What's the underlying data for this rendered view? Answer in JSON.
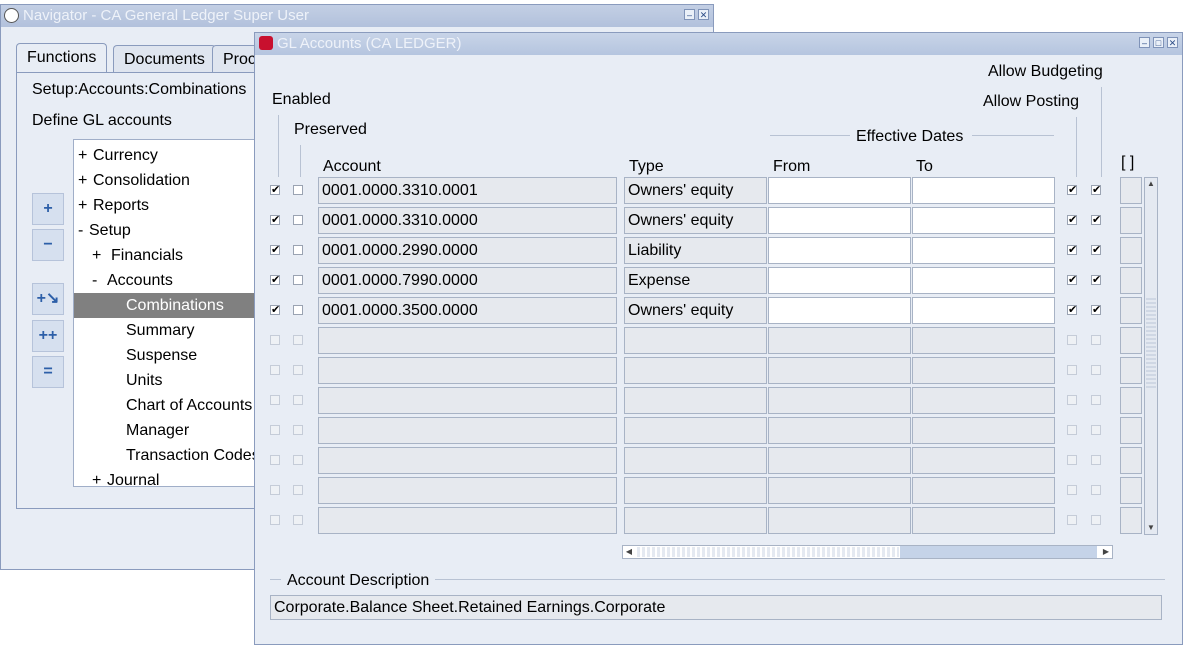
{
  "navigator": {
    "title": "Navigator - CA General Ledger Super User",
    "tabs": [
      "Functions",
      "Documents",
      "Proc"
    ],
    "path": "Setup:Accounts:Combinations",
    "description": "Define GL accounts",
    "tree": [
      {
        "prefix": "+",
        "label": "Currency"
      },
      {
        "prefix": "+",
        "label": "Consolidation"
      },
      {
        "prefix": "+",
        "label": "Reports"
      },
      {
        "prefix": "-",
        "label": "Setup"
      },
      {
        "prefix": "+",
        "label": "Financials"
      },
      {
        "prefix": "-",
        "label": "Accounts"
      },
      {
        "prefix": "",
        "label": "Combinations"
      },
      {
        "prefix": "",
        "label": "Summary"
      },
      {
        "prefix": "",
        "label": "Suspense"
      },
      {
        "prefix": "",
        "label": "Units"
      },
      {
        "prefix": "",
        "label": "Chart of Accounts"
      },
      {
        "prefix": "",
        "label": "Manager"
      },
      {
        "prefix": "",
        "label": "Transaction Codes"
      },
      {
        "prefix": "+",
        "label": "Journal"
      }
    ]
  },
  "gl": {
    "title": "GL Accounts (CA LEDGER)",
    "headers": {
      "enabled": "Enabled",
      "preserved": "Preserved",
      "account": "Account",
      "type": "Type",
      "effective_dates": "Effective Dates",
      "from": "From",
      "to": "To",
      "allow_budgeting": "Allow Budgeting",
      "allow_posting": "Allow Posting",
      "flex": "[ ]"
    },
    "rows": [
      {
        "enabled": true,
        "preserved": false,
        "account": "0001.0000.3310.0001",
        "type": "Owners' equity",
        "from": "",
        "to": "",
        "budgeting": true,
        "posting": true
      },
      {
        "enabled": true,
        "preserved": false,
        "account": "0001.0000.3310.0000",
        "type": "Owners' equity",
        "from": "",
        "to": "",
        "budgeting": true,
        "posting": true
      },
      {
        "enabled": true,
        "preserved": false,
        "account": "0001.0000.2990.0000",
        "type": "Liability",
        "from": "",
        "to": "",
        "budgeting": true,
        "posting": true
      },
      {
        "enabled": true,
        "preserved": false,
        "account": "0001.0000.7990.0000",
        "type": "Expense",
        "from": "",
        "to": "",
        "budgeting": true,
        "posting": true
      },
      {
        "enabled": true,
        "preserved": false,
        "account": "0001.0000.3500.0000",
        "type": "Owners' equity",
        "from": "",
        "to": "",
        "budgeting": true,
        "posting": true
      }
    ],
    "empty_rows": 7,
    "account_description_label": "Account Description",
    "account_description": "Corporate.Balance Sheet.Retained Earnings.Corporate"
  }
}
